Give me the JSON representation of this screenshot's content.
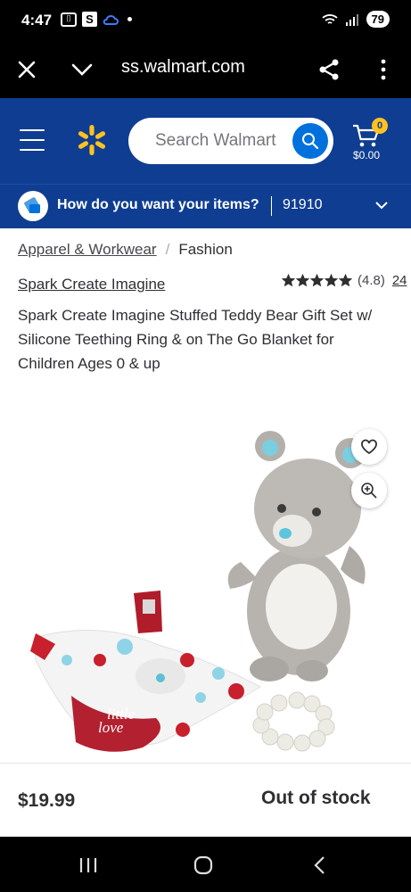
{
  "status_bar": {
    "time": "4:47",
    "battery": "79"
  },
  "browser": {
    "url": "ss.walmart.com"
  },
  "header": {
    "search_placeholder": "Search Walmart",
    "cart_count": "0",
    "cart_total": "$0.00"
  },
  "delivery": {
    "question": "How do you want your items?",
    "zip": "91910"
  },
  "breadcrumb": {
    "parent": "Apparel & Workwear",
    "separator": "/",
    "current": "Fashion"
  },
  "product": {
    "brand": "Spark Create Imagine",
    "rating": "(4.8)",
    "rating_value": 4.8,
    "review_count": "24",
    "title": "Spark Create Imagine Stuffed Teddy Bear Gift Set w/ Silicone Teething Ring & on The Go Blanket for Children Ages 0 & up",
    "blanket_text_line1": "little",
    "blanket_text_line2": "love",
    "price": "$19.99",
    "availability": "Out of stock"
  },
  "colors": {
    "walmart_blue": "#0f3d91",
    "accent_blue": "#0071dc",
    "spark_yellow": "#ffc220"
  },
  "icons": [
    "close-icon",
    "chevron-down-icon",
    "share-icon",
    "more-vert-icon",
    "menu-icon",
    "spark-logo-icon",
    "search-icon",
    "cart-icon",
    "delivery-icon",
    "heart-icon",
    "zoom-in-icon",
    "recents-icon",
    "home-icon",
    "back-icon"
  ]
}
